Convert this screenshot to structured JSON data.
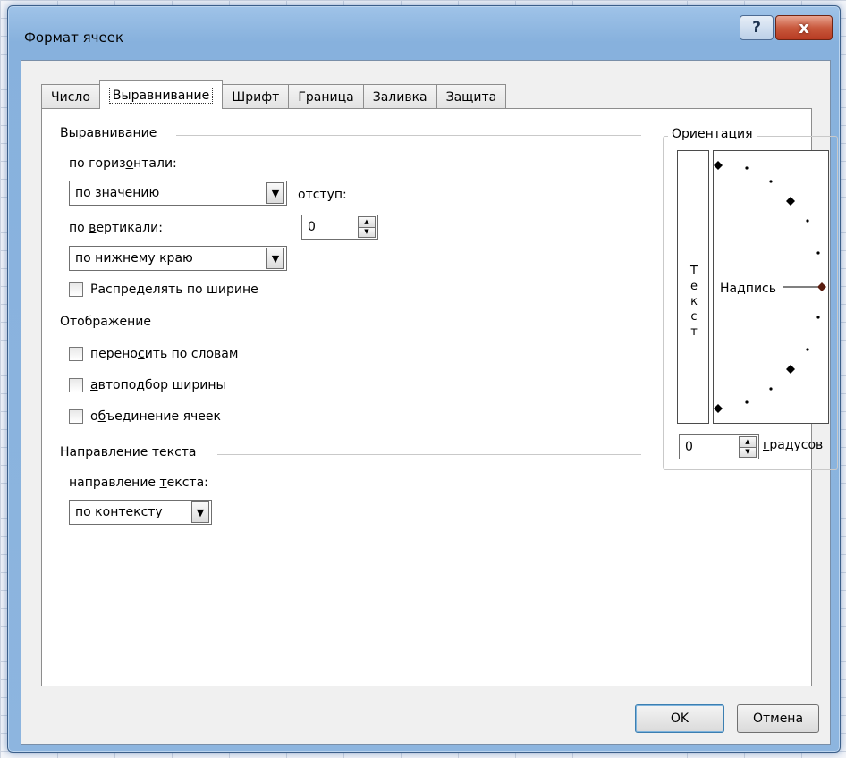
{
  "window": {
    "title": "Формат ячеек",
    "help_label": "?",
    "close_label": "x"
  },
  "tabs": [
    {
      "label": "Число"
    },
    {
      "label": "Выравнивание"
    },
    {
      "label": "Шрифт"
    },
    {
      "label": "Граница"
    },
    {
      "label": "Заливка"
    },
    {
      "label": "Защита"
    }
  ],
  "alignment": {
    "group_title": "Выравнивание",
    "horizontal_label_a": "по гориз",
    "horizontal_label_u": "о",
    "horizontal_label_b": "нтали:",
    "horizontal_value": "по значению",
    "indent_label": "отступ:",
    "indent_value": "0",
    "vertical_label_a": "по ",
    "vertical_label_u": "в",
    "vertical_label_b": "ертикали:",
    "vertical_value": "по нижнему краю",
    "distribute_label": "Распределять по ширине"
  },
  "display": {
    "group_title": "Отображение",
    "wrap_a": "перено",
    "wrap_u": "с",
    "wrap_b": "ить по словам",
    "shrink_u": "а",
    "shrink_b": "втоподбор ширины",
    "merge_a": "о",
    "merge_u": "б",
    "merge_b": "ъединение ячеек"
  },
  "direction": {
    "group_title": "Направление текста",
    "label_a": "направление ",
    "label_u": "т",
    "label_b": "екста:",
    "value": "по контексту"
  },
  "orientation": {
    "group_title": "Ориентация",
    "vertical_letters": [
      "Т",
      "е",
      "к",
      "с",
      "т"
    ],
    "dial_label": "Надпись",
    "degrees_value": "0",
    "degrees_u": "г",
    "degrees_b": "радусов"
  },
  "footer": {
    "ok_label": "OK",
    "cancel_label": "Отмена"
  }
}
